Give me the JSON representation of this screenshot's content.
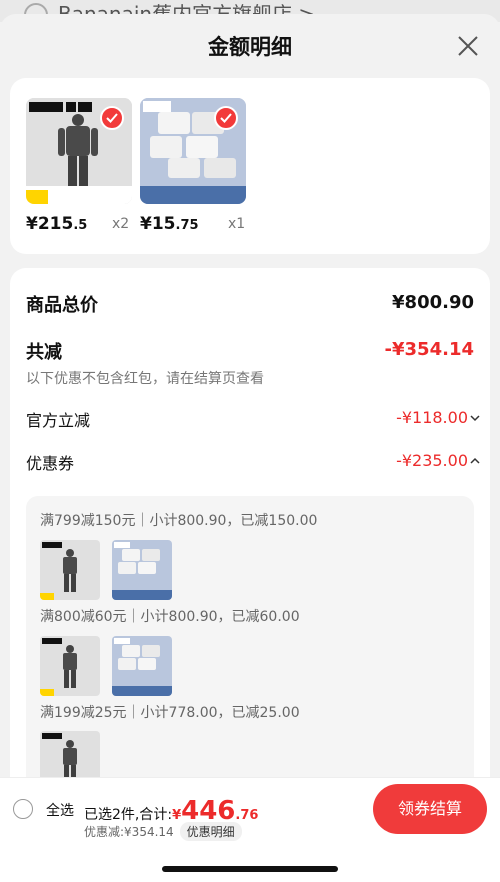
{
  "background": {
    "shop_name": "Bananain蕉内官方旗舰店 >"
  },
  "header": {
    "title": "金额明细"
  },
  "products": [
    {
      "price_main": "¥215",
      "price_decimal": ".5",
      "qty": "x2"
    },
    {
      "price_main": "¥15",
      "price_decimal": ".75",
      "qty": "x1"
    }
  ],
  "summary": {
    "total_label": "商品总价",
    "total_value": "¥800.90",
    "reduce_label": "共减",
    "reduce_value": "-¥354.14",
    "note": "以下优惠不包含红包，请在结算页查看",
    "official_label": "官方立减",
    "official_value": "-¥118.00",
    "coupon_label": "优惠券",
    "coupon_value": "-¥235.00"
  },
  "coupons": [
    {
      "text": "满799减150元｜小计800.90，已减150.00"
    },
    {
      "text": "满800减60元｜小计800.90，已减60.00"
    },
    {
      "text": "满199减25元｜小计778.00，已减25.00"
    }
  ],
  "footer": {
    "select_all": "全选",
    "selected_prefix": "已选2件,合计:",
    "amount_currency": "¥",
    "amount_main": "446",
    "amount_decimal": ".76",
    "discount_text": "优惠减:¥354.14",
    "detail_link": "优惠明细",
    "checkout": "领券结算"
  },
  "colors": {
    "accent": "#ec2b2b",
    "button": "#f03b3b"
  }
}
